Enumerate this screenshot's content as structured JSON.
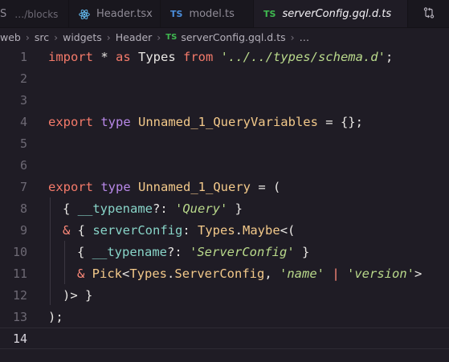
{
  "tabs": {
    "first": {
      "glyph": "S",
      "desc": "…/blocks"
    },
    "header": {
      "label": "Header.tsx"
    },
    "model": {
      "icon": "TS",
      "label": "model.ts"
    },
    "server": {
      "icon": "TS",
      "label": "serverConfig.gql.d.ts"
    },
    "actions_icon": "source-control-compare-icon"
  },
  "breadcrumb": {
    "items": [
      "web",
      "src",
      "widgets",
      "Header"
    ],
    "file_icon": "TS",
    "file": "serverConfig.gql.d.ts",
    "trailing": "…"
  },
  "editor": {
    "line_numbers": [
      "1",
      "2",
      "3",
      "4",
      "5",
      "6",
      "7",
      "8",
      "9",
      "10",
      "11",
      "12",
      "13",
      "14"
    ],
    "current_line": "14",
    "lines": {
      "l1": {
        "import": "import",
        "star": " * ",
        "as": "as",
        "name": " Types ",
        "from": "from",
        "path": " '../../types/schema.d'",
        "semi": ";"
      },
      "l4": {
        "export": "export",
        "type": " type ",
        "name": "Unnamed_1_QueryVariables",
        "rest": " = {};"
      },
      "l7": {
        "export": "export",
        "type": " type ",
        "name": "Unnamed_1_Query",
        "rest": " = ("
      },
      "l8": {
        "open": "{ ",
        "prop": "__typename",
        "mid": "?: ",
        "str": "'Query'",
        "close": " }"
      },
      "l9": {
        "amp": "& ",
        "open": "{ ",
        "prop": "serverConfig",
        "mid": ": ",
        "ns": "Types",
        "dot": ".",
        "maybe": "Maybe",
        "rest": "<("
      },
      "l10": {
        "open": "{ ",
        "prop": "__typename",
        "mid": "?: ",
        "str": "'ServerConfig'",
        "close": " }"
      },
      "l11": {
        "amp": "& ",
        "pick": "Pick",
        "lt": "<",
        "ns": "Types",
        "dot": ".",
        "sc": "ServerConfig",
        "comma": ", ",
        "s1": "'name'",
        "pipe": " | ",
        "s2": "'version'",
        "gt": ">"
      },
      "l12": {
        "text": ")> }"
      },
      "l13": {
        "text": ");"
      }
    }
  },
  "colors": {
    "background": "#1f1c25",
    "keyword": "#f47a6a",
    "type_keyword": "#b888e8",
    "type_name": "#f3c98a",
    "string": "#b9d98b",
    "property": "#88d4c8",
    "ts_blue": "#4b8edb",
    "ts_green": "#3fb950"
  }
}
